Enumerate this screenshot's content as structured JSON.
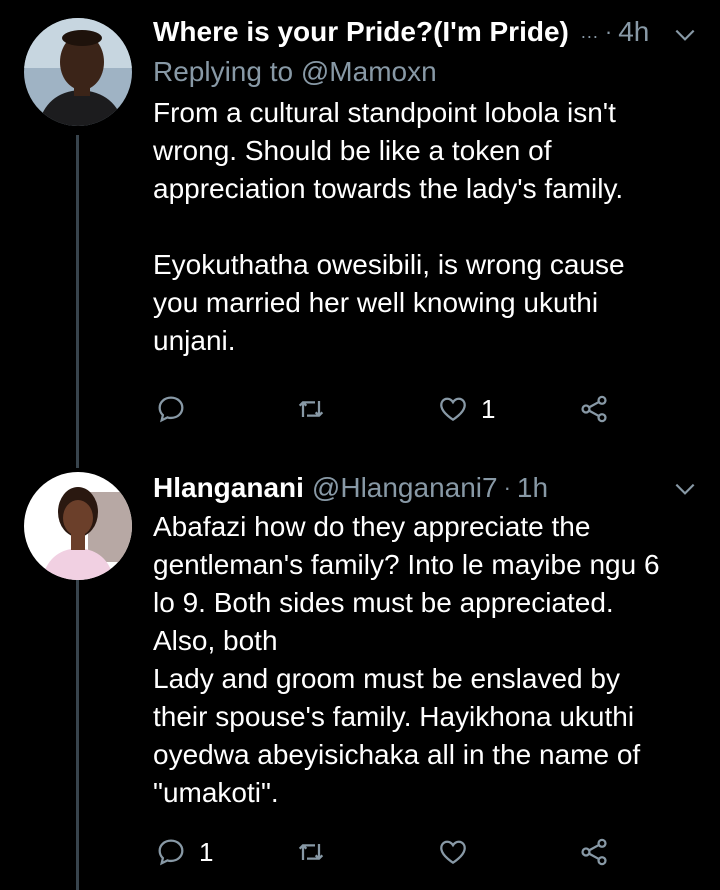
{
  "tweets": [
    {
      "display_name": "Where is your Pride?(I'm Pride)",
      "more": "...",
      "separator": "·",
      "time": "4h",
      "reply_prefix": "Replying to",
      "reply_mention": "@Mamoxn",
      "text": "From a cultural standpoint lobola isn't\nwrong. Should be like a token of\nappreciation towards the lady's family.\n\nEyokuthatha owesibili, is wrong cause\nyou married her well knowing ukuthi\nunjani.",
      "actions": {
        "reply_count": "",
        "retweet_count": "",
        "like_count": "1"
      }
    },
    {
      "display_name": "Hlanganani",
      "handle": "@Hlanganani7",
      "separator": "·",
      "time": "1h",
      "text": "Abafazi how do they appreciate the\ngentleman's family? Into le mayibe ngu 6\nlo 9. Both sides must be appreciated.\nAlso, both\nLady and groom must be enslaved by\ntheir spouse's family. Hayikhona ukuthi\noyedwa abeyisichaka all in the name of\n\"umakoti\".",
      "actions": {
        "reply_count": "1",
        "retweet_count": "",
        "like_count": ""
      }
    }
  ],
  "colors": {
    "background": "#000000",
    "secondary_text": "#8899a6",
    "thread_line": "#38444d"
  }
}
